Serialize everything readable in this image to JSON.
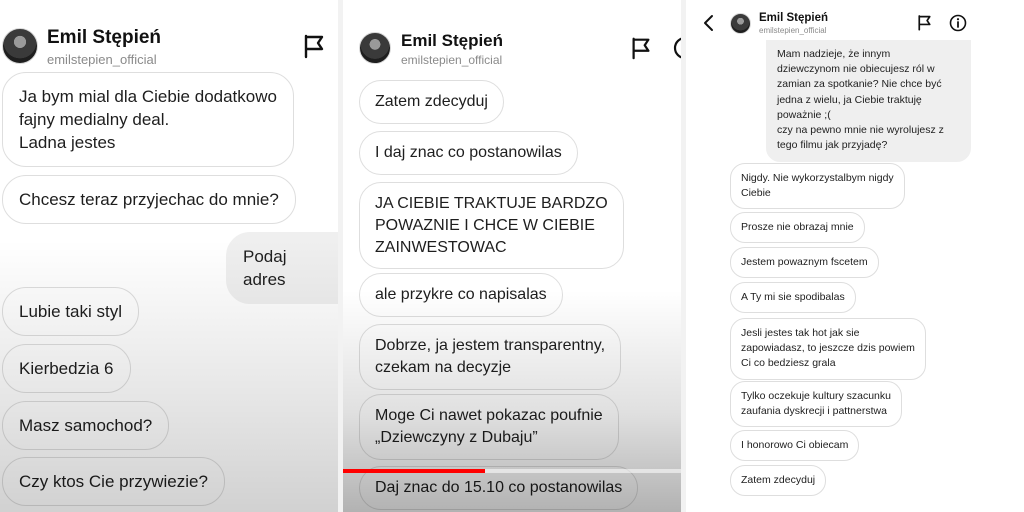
{
  "panels": [
    {
      "header": {
        "name": "Emil Stępień",
        "username": "emilstepien_official"
      },
      "messages": [
        {
          "text": "Ja bym mial dla Ciebie dodatkowo\nfajny medialny deal.\nLadna jestes",
          "from": "received"
        },
        {
          "text": "Chcesz teraz przyjechac do mnie?",
          "from": "received"
        },
        {
          "text": "Podaj adres",
          "from": "sent"
        },
        {
          "text": "Lubie taki styl",
          "from": "received"
        },
        {
          "text": "Kierbedzia 6",
          "from": "received"
        },
        {
          "text": "Masz samochod?",
          "from": "received"
        },
        {
          "text": "Czy ktos Cie przywiezie?",
          "from": "received"
        }
      ]
    },
    {
      "header": {
        "name": "Emil Stępień",
        "username": "emilstepien_official"
      },
      "messages": [
        {
          "text": "Zatem zdecyduj",
          "from": "received"
        },
        {
          "text": "I daj znac co postanowilas",
          "from": "received"
        },
        {
          "text": "JA CIEBIE TRAKTUJE BARDZO\nPOWAZNIE I CHCE W CIEBIE\nZAINWESTOWAC",
          "from": "received"
        },
        {
          "text": "ale przykre co napisalas",
          "from": "received"
        },
        {
          "text": "Dobrze, ja jestem transparentny,\nczekam na decyzje",
          "from": "received"
        },
        {
          "text": "Moge Ci nawet pokazac poufnie\n„Dziewczyny z Dubaju”",
          "from": "received"
        },
        {
          "text": "Daj znac do 15.10 co postanowilas",
          "from": "received"
        }
      ],
      "video_progress": 0.42
    },
    {
      "header": {
        "name": "Emil Stępień",
        "username": "emilstepien_official"
      },
      "messages": [
        {
          "text": "Mam nadzieje, że innym\ndziewczynom nie obiecujesz ról w\nzamian za spotkanie? Nie chce być\njedna z wielu, ja Ciebie traktuję\npoważnie ;(\nczy na pewno mnie nie wyrolujesz z\ntego filmu jak przyjadę?",
          "from": "sent"
        },
        {
          "text": "Nigdy. Nie wykorzystalbym nigdy\nCiebie",
          "from": "received"
        },
        {
          "text": "Prosze nie obrazaj mnie",
          "from": "received"
        },
        {
          "text": "Jestem powaznym fscetem",
          "from": "received"
        },
        {
          "text": "A Ty mi sie spodibalas",
          "from": "received"
        },
        {
          "text": "Jesli jestes tak hot jak sie\nzapowiadasz, to jeszcze dzis powiem\nCi co bedziesz grala",
          "from": "received"
        },
        {
          "text": "Tylko oczekuje kultury szacunku\nzaufania dyskrecji i pattnerstwa",
          "from": "received"
        },
        {
          "text": "I honorowo Ci obiecam",
          "from": "received"
        },
        {
          "text": "Zatem zdecyduj",
          "from": "received"
        }
      ]
    }
  ],
  "icons": {
    "report": "flag-icon",
    "info": "info-icon",
    "back": "back-arrow-icon",
    "more": "circle-icon"
  },
  "colors": {
    "sent_bubble": "#efefef",
    "received_border": "#dedede",
    "progress": "#ff0000"
  }
}
